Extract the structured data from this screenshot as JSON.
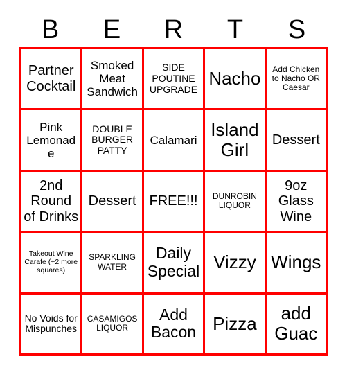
{
  "card": {
    "header_letters": [
      "B",
      "E",
      "R",
      "T",
      "S"
    ],
    "border_color": "#FF0000",
    "text_color": "#000000",
    "background_color": "#FFFFFF",
    "rows": 5,
    "columns": 5,
    "cells": [
      [
        {
          "text": "Partner Cocktail",
          "size": "md"
        },
        {
          "text": "Smoked Meat Sandwich",
          "size": "sm"
        },
        {
          "text": "SIDE POUTINE UPGRADE",
          "size": "xs"
        },
        {
          "text": "Nacho",
          "size": "xl"
        },
        {
          "text": "Add Chicken to Nacho OR Caesar",
          "size": "xxs"
        }
      ],
      [
        {
          "text": "Pink Lemonade",
          "size": "sm"
        },
        {
          "text": "DOUBLE BURGER PATTY",
          "size": "xs"
        },
        {
          "text": "Calamari",
          "size": "sm"
        },
        {
          "text": "Island Girl",
          "size": "xl"
        },
        {
          "text": "Dessert",
          "size": "md"
        }
      ],
      [
        {
          "text": "2nd Round of Drinks",
          "size": "md"
        },
        {
          "text": "Dessert",
          "size": "md"
        },
        {
          "text": "FREE!!!",
          "size": "md"
        },
        {
          "text": "DUNROBIN LIQUOR",
          "size": "xxs"
        },
        {
          "text": "9oz Glass Wine",
          "size": "md"
        }
      ],
      [
        {
          "text": "Takeout Wine Carafe (+2 more squares)",
          "size": "tiny"
        },
        {
          "text": "SPARKLING WATER",
          "size": "xxs"
        },
        {
          "text": "Daily Special",
          "size": "lg"
        },
        {
          "text": "Vizzy",
          "size": "xl"
        },
        {
          "text": "Wings",
          "size": "xl"
        }
      ],
      [
        {
          "text": "No Voids for Mispunches",
          "size": "xs"
        },
        {
          "text": "CASAMIGOS LIQUOR",
          "size": "xxs"
        },
        {
          "text": "Add Bacon",
          "size": "lg"
        },
        {
          "text": "Pizza",
          "size": "xl"
        },
        {
          "text": "add Guac",
          "size": "xl"
        }
      ]
    ]
  }
}
